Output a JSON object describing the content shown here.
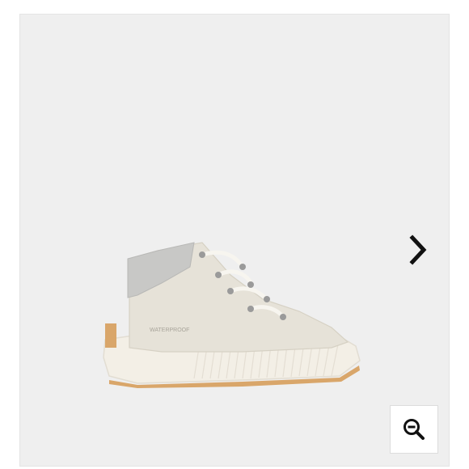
{
  "gallery": {
    "background_color": "#efefef",
    "image_label": "WATERPROOF",
    "next_icon": "chevron-right-icon",
    "zoom_icon": "zoom-out-icon"
  },
  "product": {
    "upper_color": "#e6e2d8",
    "collar_color": "#c8c8c6",
    "sole_color": "#f3efe6",
    "gum_color": "#d9a66a",
    "lace_color": "#f7f5ef",
    "hardware_color": "#9a9a9a"
  }
}
